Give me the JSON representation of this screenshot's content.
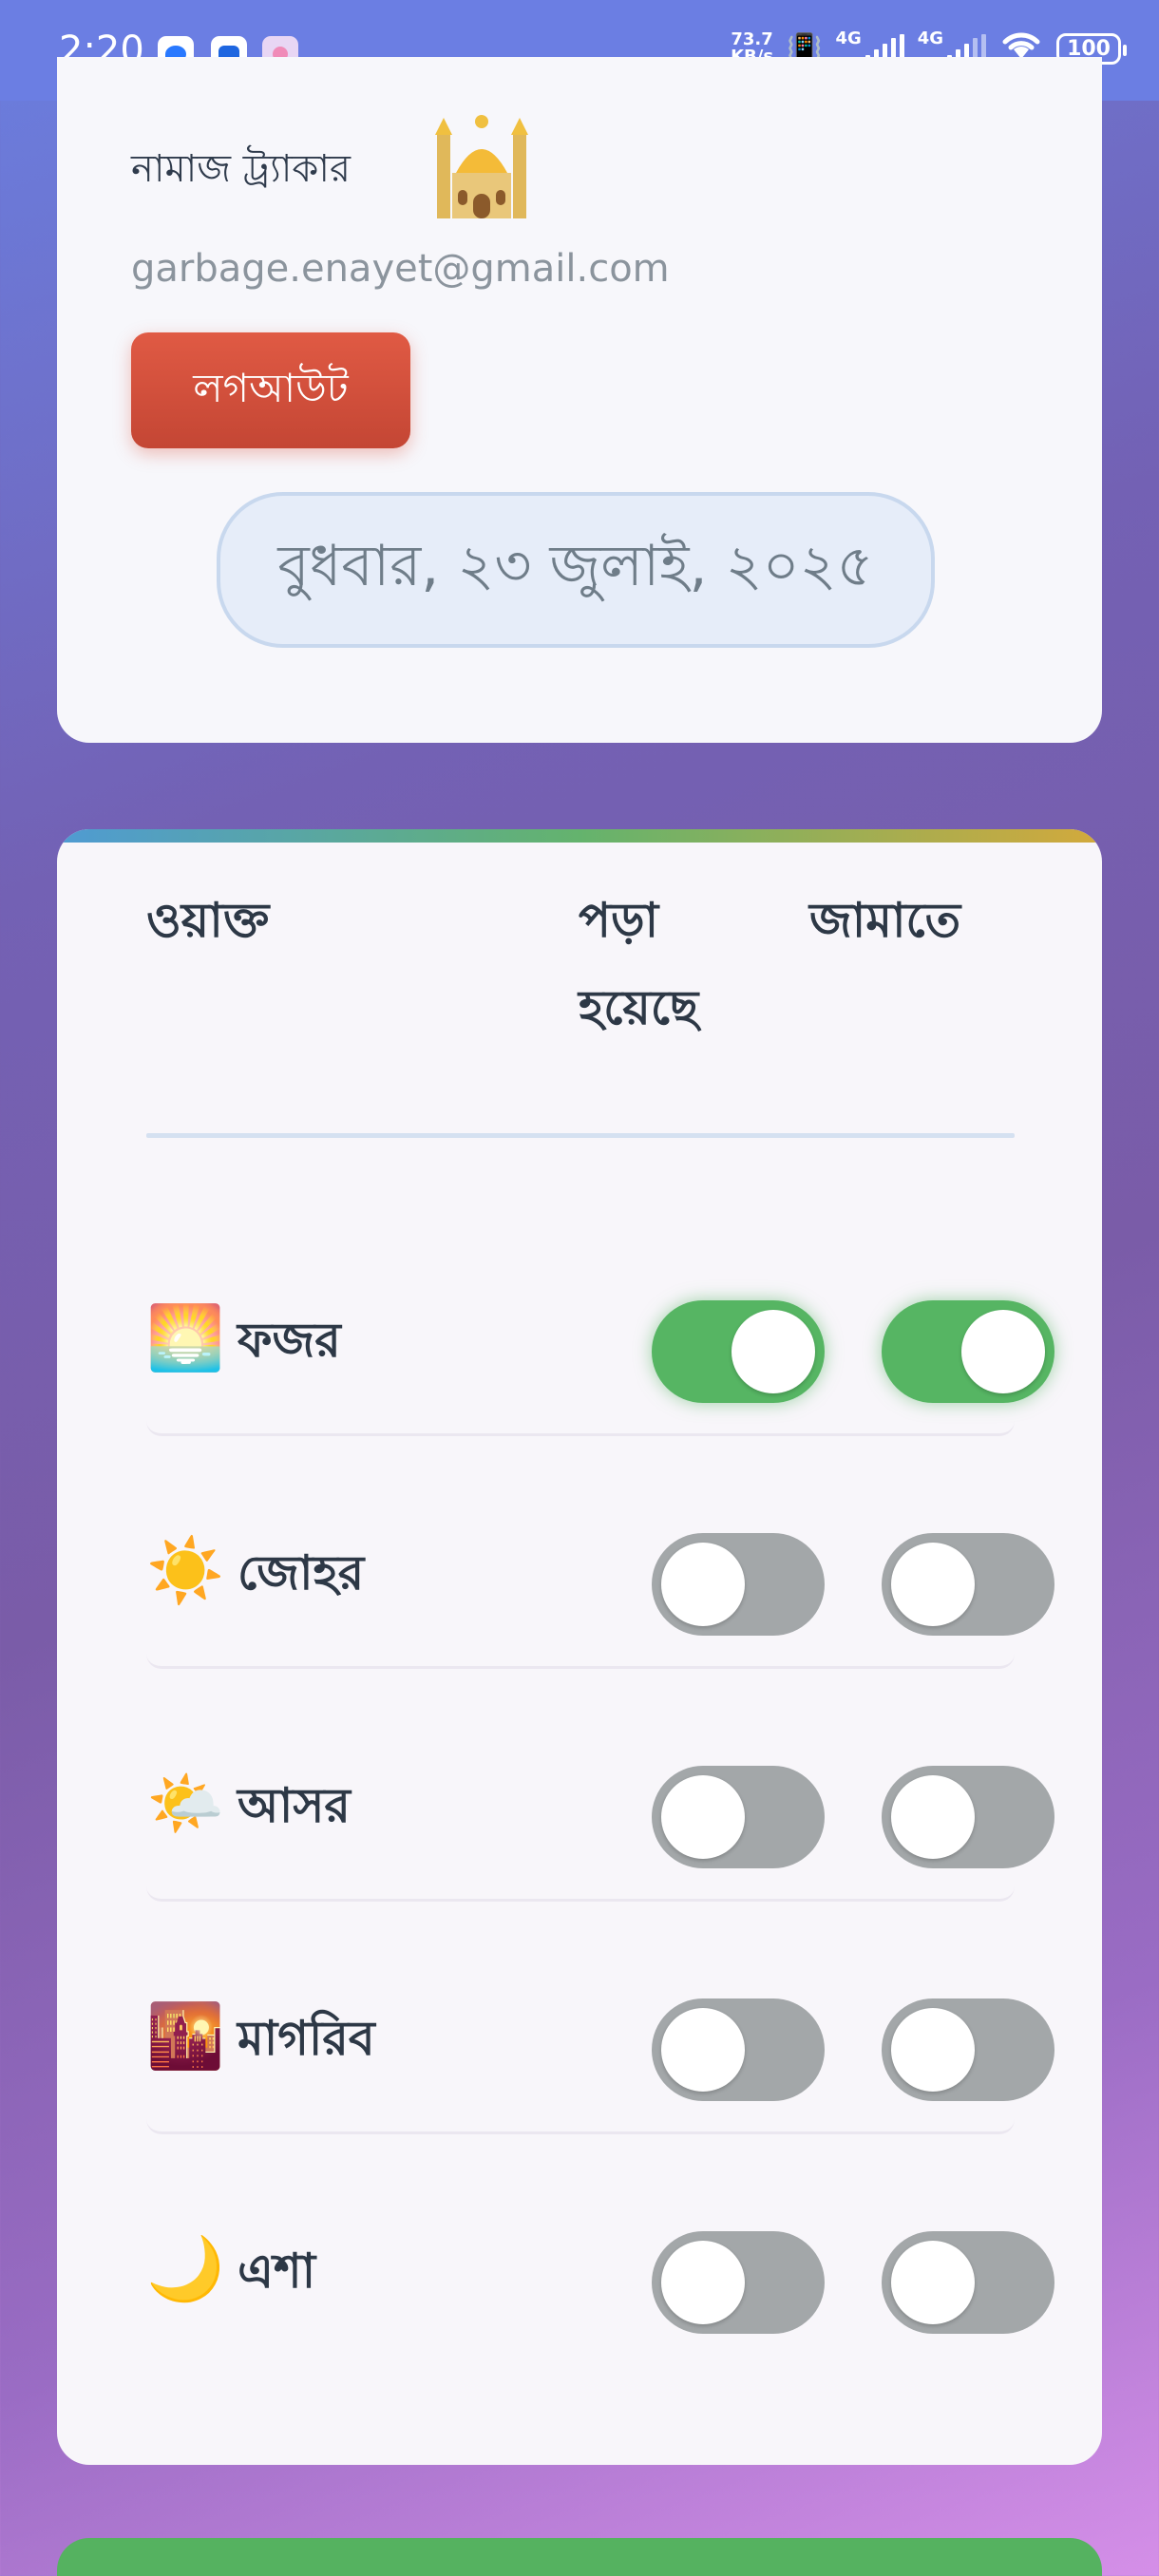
{
  "status_bar": {
    "time": "2:20",
    "net_speed_top": "73.7",
    "net_speed_bottom": "KB/s",
    "net_type_1": "4G",
    "net_type_2": "4G",
    "battery": "100"
  },
  "header": {
    "app_title": "নামাজ ট্র্যাকার",
    "email": "garbage.enayet@gmail.com",
    "logout_label": "লগআউট",
    "date": "বুধবার, ২৩ জুলাই, ২০২৫"
  },
  "table": {
    "col_waqt": "ওয়াক্ত",
    "col_prayed_1": "পড়া",
    "col_prayed_2": "হয়েছে",
    "col_jamaat": "জামাতে",
    "rows": [
      {
        "emoji": "🌅",
        "label": "ফজর",
        "prayed": true,
        "jamaat": true
      },
      {
        "emoji": "☀️",
        "label": "জোহর",
        "prayed": false,
        "jamaat": false
      },
      {
        "emoji": "🌤️",
        "label": "আসর",
        "prayed": false,
        "jamaat": false
      },
      {
        "emoji": "🌇",
        "label": "মাগরিব",
        "prayed": false,
        "jamaat": false
      },
      {
        "emoji": "🌙",
        "label": "এশা",
        "prayed": false,
        "jamaat": false
      }
    ]
  },
  "colors": {
    "toggle_on": "#56b563",
    "toggle_off": "#a3a7a9",
    "logout": "#d44f3b",
    "accent_bottom": "#55b260"
  }
}
